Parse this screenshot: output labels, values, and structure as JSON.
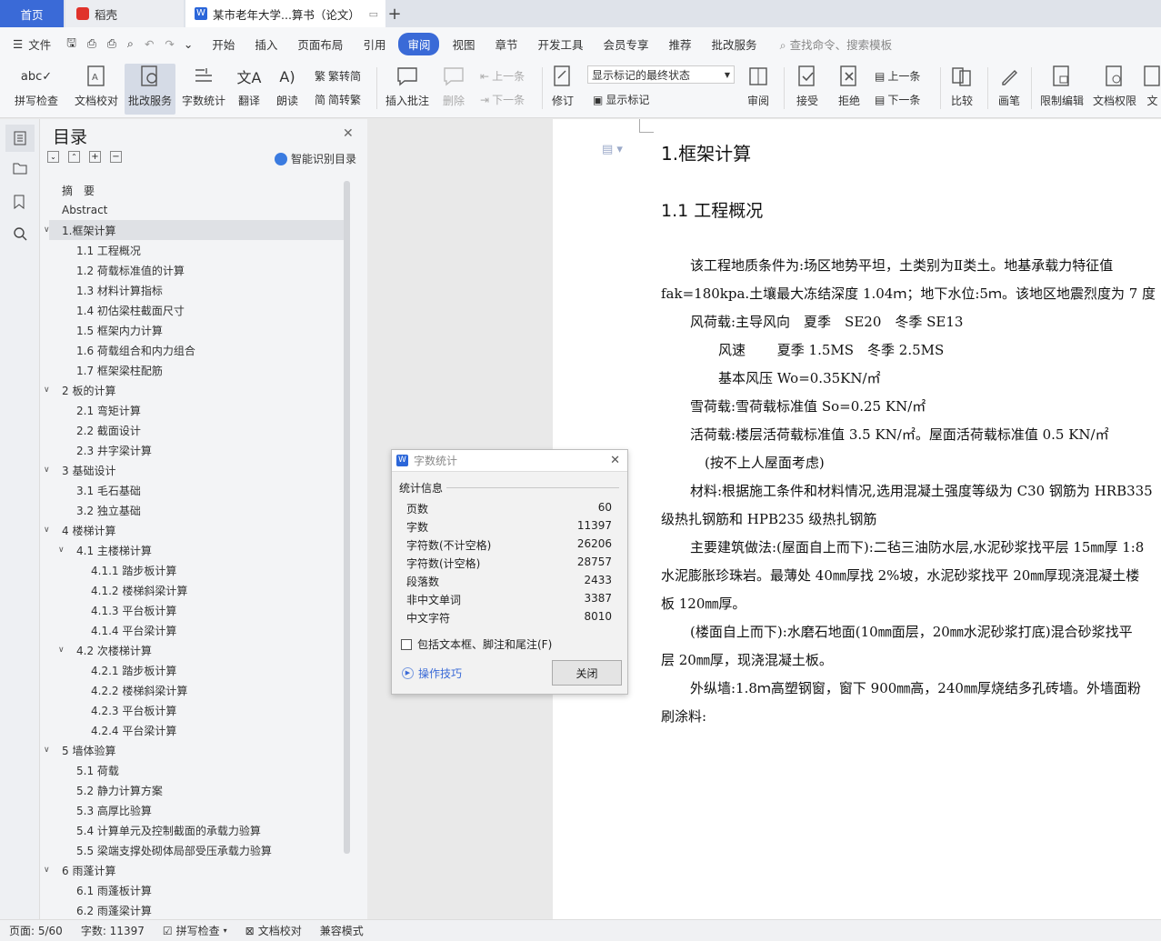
{
  "tabs": {
    "home": "首页",
    "daoke": "稻壳",
    "doc": "某市老年大学...算书（论文）",
    "add": "+"
  },
  "menu": [
    "文件",
    "开始",
    "插入",
    "页面布局",
    "引用",
    "审阅",
    "视图",
    "章节",
    "开发工具",
    "会员专享",
    "推荐",
    "批改服务"
  ],
  "menu_active": "审阅",
  "search_placeholder": "查找命令、搜索模板",
  "ribbon": {
    "spell": "拼写检查",
    "proof": "文档校对",
    "correct": "批改服务",
    "wordcount": "字数统计",
    "translate": "翻译",
    "read": "朗读",
    "trad": "繁转简",
    "simp": "简转繁",
    "insert_comment": "插入批注",
    "delete": "删除",
    "prev_comment": "上一条",
    "next_comment": "下一条",
    "revise": "修订",
    "markup_state": "显示标记的最终状态",
    "show_markup": "显示标记",
    "review": "审阅",
    "accept": "接受",
    "reject": "拒绝",
    "prev": "上一条",
    "next": "下一条",
    "compare": "比较",
    "pen": "画笔",
    "restrict": "限制编辑",
    "doc_perm": "文档权限",
    "doc_cut": "文"
  },
  "toc": {
    "title": "目录",
    "smart": "智能识别目录",
    "items": [
      {
        "t": "摘　要",
        "l": 1,
        "c": ""
      },
      {
        "t": "Abstract",
        "l": 1,
        "c": ""
      },
      {
        "t": "1.框架计算",
        "l": 1,
        "c": "v",
        "sel": true
      },
      {
        "t": "1.1 工程概况",
        "l": 2,
        "c": ""
      },
      {
        "t": "1.2 荷载标准值的计算",
        "l": 2,
        "c": ""
      },
      {
        "t": "1.3 材料计算指标",
        "l": 2,
        "c": ""
      },
      {
        "t": "1.4 初估梁柱截面尺寸",
        "l": 2,
        "c": ""
      },
      {
        "t": "1.5 框架内力计算",
        "l": 2,
        "c": ""
      },
      {
        "t": "1.6 荷载组合和内力组合",
        "l": 2,
        "c": ""
      },
      {
        "t": "1.7 框架梁柱配筋",
        "l": 2,
        "c": ""
      },
      {
        "t": "2 板的计算",
        "l": 1,
        "c": "v"
      },
      {
        "t": "2.1 弯矩计算",
        "l": 2,
        "c": ""
      },
      {
        "t": "2.2 截面设计",
        "l": 2,
        "c": ""
      },
      {
        "t": "2.3 井字梁计算",
        "l": 2,
        "c": ""
      },
      {
        "t": "3 基础设计",
        "l": 1,
        "c": "v"
      },
      {
        "t": "3.1  毛石基础",
        "l": 2,
        "c": ""
      },
      {
        "t": "3.2 独立基础",
        "l": 2,
        "c": ""
      },
      {
        "t": "4 楼梯计算",
        "l": 1,
        "c": "v"
      },
      {
        "t": "4.1 主楼梯计算",
        "l": 2,
        "c": "v"
      },
      {
        "t": "4.1.1 踏步板计算",
        "l": 3,
        "c": ""
      },
      {
        "t": "4.1.2 楼梯斜梁计算",
        "l": 3,
        "c": ""
      },
      {
        "t": "4.1.3 平台板计算",
        "l": 3,
        "c": ""
      },
      {
        "t": "4.1.4 平台梁计算",
        "l": 3,
        "c": ""
      },
      {
        "t": "4.2 次楼梯计算",
        "l": 2,
        "c": "v"
      },
      {
        "t": "4.2.1 踏步板计算",
        "l": 3,
        "c": ""
      },
      {
        "t": "4.2.2 楼梯斜梁计算",
        "l": 3,
        "c": ""
      },
      {
        "t": "4.2.3 平台板计算",
        "l": 3,
        "c": ""
      },
      {
        "t": "4.2.4 平台梁计算",
        "l": 3,
        "c": ""
      },
      {
        "t": "5 墙体验算",
        "l": 1,
        "c": "v"
      },
      {
        "t": "5.1 荷载",
        "l": 2,
        "c": ""
      },
      {
        "t": "5.2 静力计算方案",
        "l": 2,
        "c": ""
      },
      {
        "t": "5.3 高厚比验算",
        "l": 2,
        "c": ""
      },
      {
        "t": "5.4 计算单元及控制截面的承载力验算",
        "l": 2,
        "c": ""
      },
      {
        "t": "5.5 梁端支撑处砌体局部受压承载力验算",
        "l": 2,
        "c": ""
      },
      {
        "t": "6 雨蓬计算",
        "l": 1,
        "c": "v"
      },
      {
        "t": "6.1 雨蓬板计算",
        "l": 2,
        "c": ""
      },
      {
        "t": "6.2 雨蓬梁计算",
        "l": 2,
        "c": ""
      }
    ]
  },
  "doc": {
    "h1": "1.框架计算",
    "h2": "1.1 工程概况",
    "lines": [
      "该工程地质条件为:场区地势平坦，土类别为Ⅱ类土。地基承载力特征值",
      "fak=180kpa.土壤最大冻结深度 1.04ｍ；地下水位:5ｍ。该地区地震烈度为 7 度",
      "风荷载:主导风向　夏季　SE20　冬季 SE13",
      "风速　　 夏季 1.5MS　冬季 2.5MS",
      "基本风压 Wo=0.35KN/㎡",
      "雪荷载:雪荷载标准值 So=0.25 KN/㎡",
      "活荷载:楼层活荷载标准值 3.5 KN/㎡。屋面活荷载标准值 0.5 KN/㎡",
      "(按不上人屋面考虑)",
      "材料:根据施工条件和材料情况,选用混凝土强度等级为 C30 钢筋为 HRB335",
      "级热扎钢筋和 HPB235 级热扎钢筋",
      "主要建筑做法:(屋面自上而下):二毡三油防水层,水泥砂浆找平层 15㎜厚 1:8",
      "水泥膨胀珍珠岩。最薄处 40㎜厚找 2%坡，水泥砂浆找平 20㎜厚现浇混凝土楼",
      "板 120㎜厚。",
      "(楼面自上而下):水磨石地面(10㎜面层，20㎜水泥砂浆打底)混合砂浆找平",
      "层 20㎜厚，现浇混凝土板。",
      "外纵墙:1.8ｍ高塑钢窗，窗下 900㎜高，240㎜厚烧结多孔砖墙。外墙面粉",
      "刷涂料:"
    ]
  },
  "dialog": {
    "title": "字数统计",
    "section": "统计信息",
    "rows": [
      {
        "k": "页数",
        "v": "60"
      },
      {
        "k": "字数",
        "v": "11397"
      },
      {
        "k": "字符数(不计空格)",
        "v": "26206"
      },
      {
        "k": "字符数(计空格)",
        "v": "28757"
      },
      {
        "k": "段落数",
        "v": "2433"
      },
      {
        "k": "非中文单词",
        "v": "3387"
      },
      {
        "k": "中文字符",
        "v": "8010"
      }
    ],
    "include": "包括文本框、脚注和尾注(F)",
    "tips": "操作技巧",
    "close": "关闭"
  },
  "status": {
    "page": "页面: 5/60",
    "words": "字数: 11397",
    "spell": "拼写检查",
    "proof": "文档校对",
    "compat": "兼容模式"
  }
}
